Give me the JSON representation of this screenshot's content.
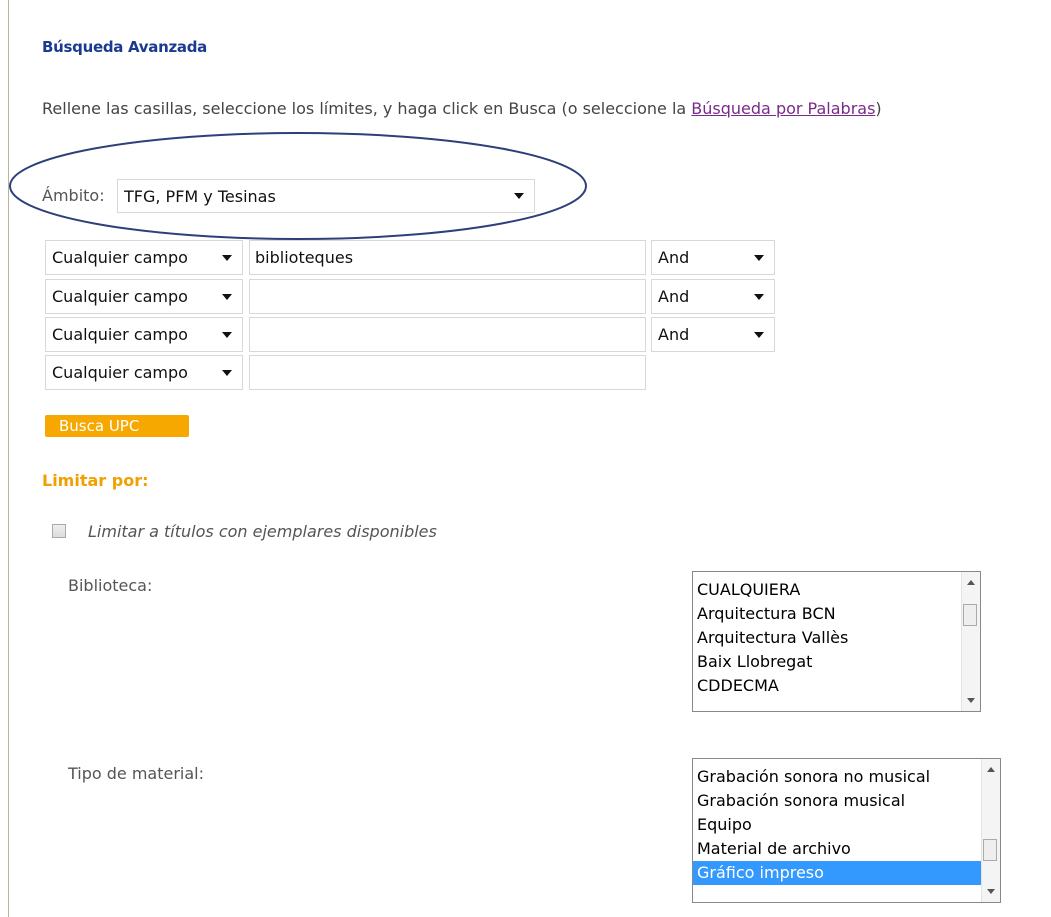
{
  "header": {
    "title": "Búsqueda Avanzada"
  },
  "intro": {
    "text": "Rellene las casillas, seleccione los límites, y haga click en Busca (o seleccione la ",
    "link": "Búsqueda por Palabras",
    "suffix": ")"
  },
  "ambito": {
    "label": "Ámbito:",
    "value": "TFG, PFM y Tesinas"
  },
  "rows": [
    {
      "field": "Cualquier campo",
      "term": "biblioteques",
      "operator": "And"
    },
    {
      "field": "Cualquier campo",
      "term": "",
      "operator": "And"
    },
    {
      "field": "Cualquier campo",
      "term": "",
      "operator": "And"
    },
    {
      "field": "Cualquier campo",
      "term": ""
    }
  ],
  "search_button": "Busca UPC",
  "limits": {
    "heading": "Limitar por:",
    "available_only": {
      "label": "Limitar a títulos con ejemplares disponibles",
      "checked": false
    },
    "library": {
      "label": "Biblioteca:",
      "options": [
        "CUALQUIERA",
        "Arquitectura BCN",
        "Arquitectura Vallès",
        "Baix Llobregat",
        "CDDECMA"
      ]
    },
    "material": {
      "label": "Tipo de material:",
      "options": [
        "Grabación sonora no musical",
        "Grabación sonora musical",
        "Equipo",
        "Material de archivo",
        "Gráfico impreso"
      ],
      "selected": "Gráfico impreso"
    }
  },
  "annotation": {
    "shape": "ellipse",
    "color": "#2e3f7a"
  },
  "colors": {
    "title": "#1a3a8f",
    "button": "#f6a800",
    "limit_heading": "#f0a000",
    "selection": "#3399ff"
  }
}
